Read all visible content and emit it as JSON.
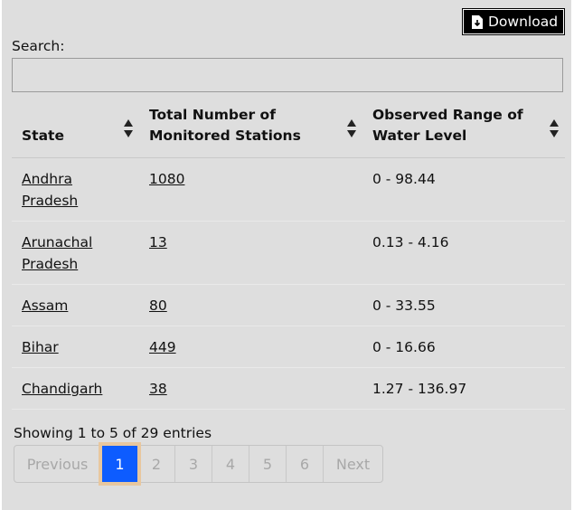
{
  "toolbar": {
    "download_label": "Download",
    "download_icon": "file-download-icon"
  },
  "search": {
    "label": "Search:",
    "value": "",
    "placeholder": ""
  },
  "table": {
    "headers": [
      "State",
      "Total Number of Monitored Stations",
      "Observed Range of Water Level"
    ],
    "rows": [
      {
        "state": "Andhra Pradesh",
        "stations": "1080",
        "range": "0 - 98.44"
      },
      {
        "state": "Arunachal Pradesh",
        "stations": "13",
        "range": "0.13 - 4.16"
      },
      {
        "state": "Assam",
        "stations": "80",
        "range": "0 - 33.55"
      },
      {
        "state": "Bihar",
        "stations": "449",
        "range": "0 - 16.66"
      },
      {
        "state": "Chandigarh",
        "stations": "38",
        "range": "1.27 - 136.97"
      }
    ]
  },
  "info": "Showing 1 to 5 of 29 entries",
  "pagination": {
    "previous": "Previous",
    "pages": [
      "1",
      "2",
      "3",
      "4",
      "5",
      "6"
    ],
    "active_page": "1",
    "next": "Next"
  },
  "colors": {
    "active_page": "#0d5cff",
    "focus_ring": "#e8c79e",
    "download_bg": "#000000"
  }
}
